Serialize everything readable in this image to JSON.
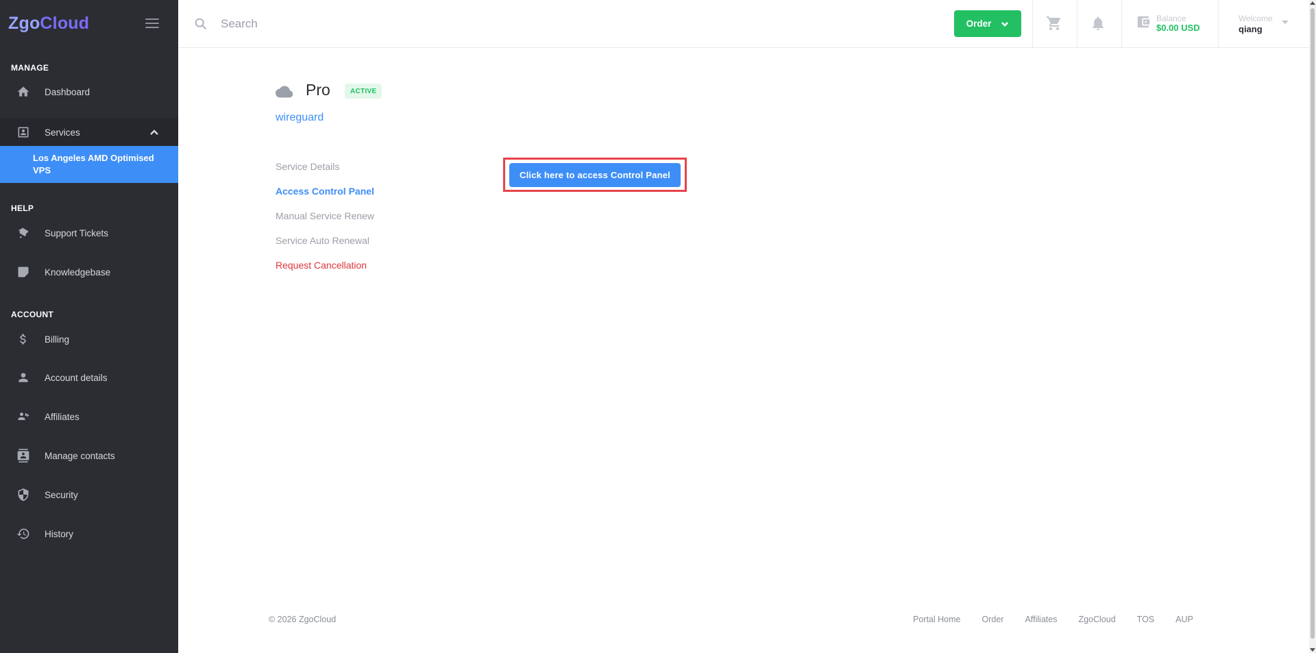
{
  "brand": {
    "part1": "Zgo",
    "part2": "Cloud"
  },
  "sidebar": {
    "sections": {
      "manage": "MANAGE",
      "help": "HELP",
      "account": "ACCOUNT"
    },
    "items": {
      "dashboard": "Dashboard",
      "services": "Services",
      "services_sub": "Los Angeles AMD Optimised VPS",
      "support_tickets": "Support Tickets",
      "knowledgebase": "Knowledgebase",
      "billing": "Billing",
      "account_details": "Account details",
      "affiliates": "Affiliates",
      "manage_contacts": "Manage contacts",
      "security": "Security",
      "history": "History"
    }
  },
  "topbar": {
    "search_placeholder": "Search",
    "order_label": "Order",
    "balance_label": "Balance",
    "balance_value": "$0.00 USD",
    "welcome_label": "Welcome",
    "username": "qiang"
  },
  "service": {
    "title": "Pro",
    "status": "ACTIVE",
    "hostname": "wireguard",
    "menu": {
      "details": "Service Details",
      "control_panel": "Access Control Panel",
      "manual_renew": "Manual Service Renew",
      "auto_renewal": "Service Auto Renewal",
      "cancel": "Request Cancellation"
    },
    "control_panel_button": "Click here to access Control Panel"
  },
  "footer": {
    "copyright": "© 2026 ZgoCloud",
    "links": {
      "portal_home": "Portal Home",
      "order": "Order",
      "affiliates": "Affiliates",
      "zgocloud": "ZgoCloud",
      "tos": "TOS",
      "aup": "AUP"
    }
  },
  "colors": {
    "sidebar_bg": "#2b2d33",
    "accent_blue": "#3e8ef7",
    "accent_green": "#22c063",
    "danger": "#e0343b"
  }
}
